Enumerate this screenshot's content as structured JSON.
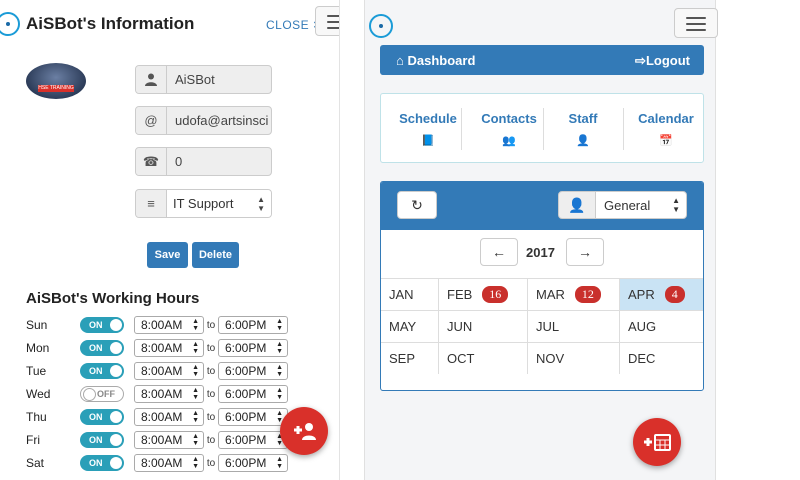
{
  "left": {
    "title": "AiSBot's Information",
    "close_label": "CLOSE",
    "close_x": "✖",
    "avatar_caption": "HSE TRAINING",
    "fields": {
      "name": "AiSBot",
      "email": "udofa@artsinsci",
      "phone": "0",
      "department": "IT Support"
    },
    "save_label": "Save",
    "delete_label": "Delete",
    "working_hours_title": "AiSBot's Working Hours",
    "to_label": "to",
    "days": [
      {
        "day": "Sun",
        "toggle": "ON",
        "start": "8:00AM",
        "end": "6:00PM"
      },
      {
        "day": "Mon",
        "toggle": "ON",
        "start": "8:00AM",
        "end": "6:00PM"
      },
      {
        "day": "Tue",
        "toggle": "ON",
        "start": "8:00AM",
        "end": "6:00PM"
      },
      {
        "day": "Wed",
        "toggle": "OFF",
        "start": "8:00AM",
        "end": "6:00PM"
      },
      {
        "day": "Thu",
        "toggle": "ON",
        "start": "8:00AM",
        "end": "6:00PM"
      },
      {
        "day": "Fri",
        "toggle": "ON",
        "start": "8:00AM",
        "end": "6:00PM"
      },
      {
        "day": "Sat",
        "toggle": "ON",
        "start": "8:00AM",
        "end": "6:00PM"
      }
    ]
  },
  "right": {
    "dashboard_label": "Dashboard",
    "logout_label": "Logout",
    "nav": [
      {
        "label": "Schedule",
        "icon": "book-icon"
      },
      {
        "label": "Contacts",
        "icon": "users-icon"
      },
      {
        "label": "Staff",
        "icon": "user-md-icon"
      },
      {
        "label": "Calendar",
        "icon": "calendar-icon"
      }
    ],
    "group_select": "General",
    "year": "2017",
    "months": [
      {
        "name": "JAN",
        "badge": ""
      },
      {
        "name": "FEB",
        "badge": "16"
      },
      {
        "name": "MAR",
        "badge": "12"
      },
      {
        "name": "APR",
        "badge": "4",
        "selected": true
      },
      {
        "name": "MAY",
        "badge": ""
      },
      {
        "name": "JUN",
        "badge": ""
      },
      {
        "name": "JUL",
        "badge": ""
      },
      {
        "name": "AUG",
        "badge": ""
      },
      {
        "name": "SEP",
        "badge": ""
      },
      {
        "name": "OCT",
        "badge": ""
      },
      {
        "name": "NOV",
        "badge": ""
      },
      {
        "name": "DEC",
        "badge": ""
      }
    ]
  },
  "colors": {
    "primary": "#337ab7",
    "danger": "#d9302a",
    "toggle_on": "#2a9fb8",
    "selected_month": "#c9e3f4"
  }
}
